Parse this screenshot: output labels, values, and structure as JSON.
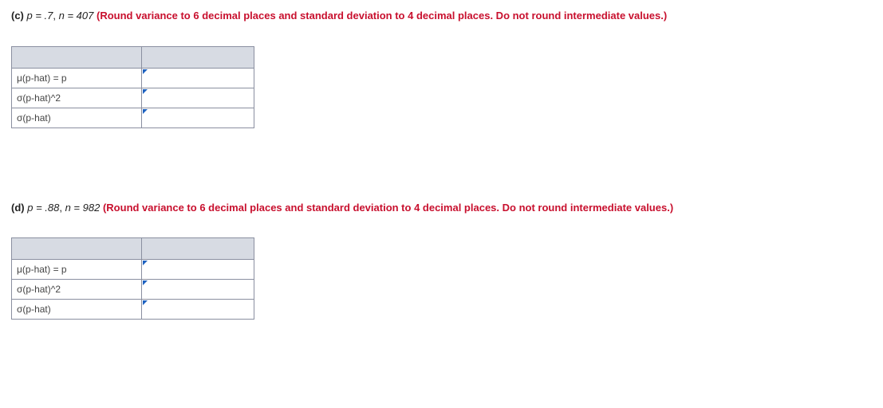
{
  "problems": [
    {
      "part": "(c)",
      "p_text": "p = .7",
      "n_text": "n = 407",
      "instruction": "(Round variance to 6 decimal places and standard deviation to 4 decimal places. Do not round intermediate values.)",
      "rows": [
        {
          "label": "μ(p-hat) = p",
          "value": ""
        },
        {
          "label": "σ(p-hat)^2",
          "value": ""
        },
        {
          "label": "σ(p-hat)",
          "value": ""
        }
      ]
    },
    {
      "part": "(d)",
      "p_text": "p = .88",
      "n_text": "n = 982",
      "instruction": "(Round variance to 6 decimal places and standard deviation to 4 decimal places. Do not round intermediate values.)",
      "rows": [
        {
          "label": "μ(p-hat) = p",
          "value": ""
        },
        {
          "label": "σ(p-hat)^2",
          "value": ""
        },
        {
          "label": "σ(p-hat)",
          "value": ""
        }
      ]
    }
  ]
}
